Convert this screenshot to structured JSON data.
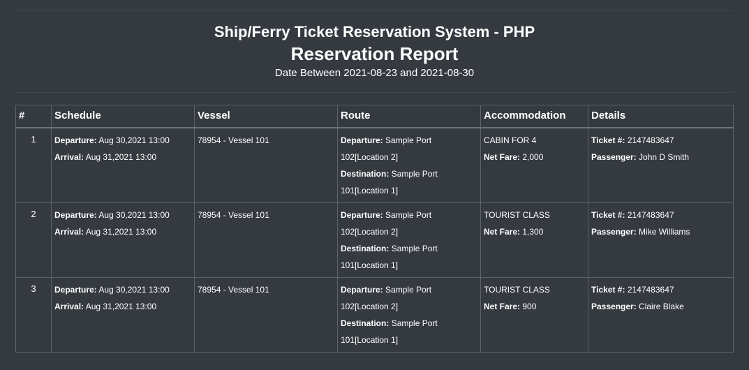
{
  "header": {
    "system_name": "Ship/Ferry Ticket Reservation System - PHP",
    "report_title": "Reservation Report",
    "date_range": "Date Between 2021-08-23 and 2021-08-30"
  },
  "table": {
    "columns": [
      "#",
      "Schedule",
      "Vessel",
      "Route",
      "Accommodation",
      "Details"
    ],
    "labels": {
      "departure": "Departure:",
      "arrival": "Arrival:",
      "destination": "Destination:",
      "net_fare": "Net Fare:",
      "ticket": "Ticket #:",
      "passenger": "Passenger:"
    },
    "rows": [
      {
        "num": "1",
        "departure": "Aug 30,2021 13:00",
        "arrival": "Aug 31,2021 13:00",
        "vessel": "78954 - Vessel 101",
        "route_departure_a": "Sample Port",
        "route_departure_b": "102[Location 2]",
        "route_destination_a": "Sample Port",
        "route_destination_b": "101[Location 1]",
        "accommodation": "CABIN FOR 4",
        "net_fare": "2,000",
        "ticket": "2147483647",
        "passenger": "John D Smith"
      },
      {
        "num": "2",
        "departure": "Aug 30,2021 13:00",
        "arrival": "Aug 31,2021 13:00",
        "vessel": "78954 - Vessel 101",
        "route_departure_a": "Sample Port",
        "route_departure_b": "102[Location 2]",
        "route_destination_a": "Sample Port",
        "route_destination_b": "101[Location 1]",
        "accommodation": "TOURIST CLASS",
        "net_fare": "1,300",
        "ticket": "2147483647",
        "passenger": "Mike Williams"
      },
      {
        "num": "3",
        "departure": "Aug 30,2021 13:00",
        "arrival": "Aug 31,2021 13:00",
        "vessel": "78954 - Vessel 101",
        "route_departure_a": "Sample Port",
        "route_departure_b": "102[Location 2]",
        "route_destination_a": "Sample Port",
        "route_destination_b": "101[Location 1]",
        "accommodation": "TOURIST CLASS",
        "net_fare": "900",
        "ticket": "2147483647",
        "passenger": "Claire Blake"
      }
    ]
  }
}
